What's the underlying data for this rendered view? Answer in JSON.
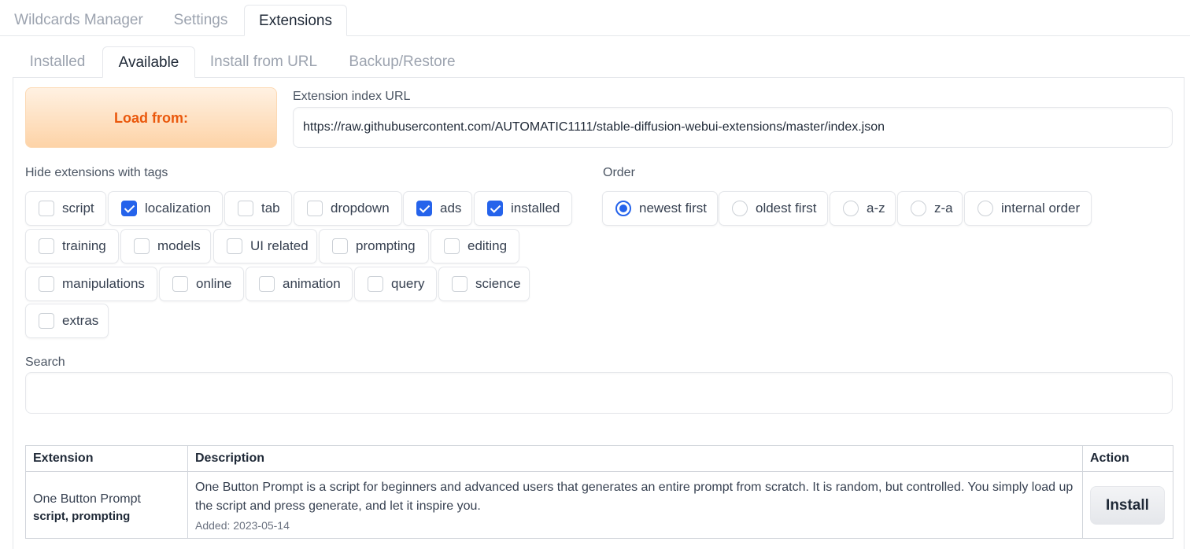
{
  "top_tabs": [
    "Wildcards Manager",
    "Settings",
    "Extensions"
  ],
  "sub_tabs": [
    "Installed",
    "Available",
    "Install from URL",
    "Backup/Restore"
  ],
  "load": {
    "button_label": "Load from:",
    "url_label": "Extension index URL",
    "url_value": "https://raw.githubusercontent.com/AUTOMATIC1111/stable-diffusion-webui-extensions/master/index.json"
  },
  "hide_tags": {
    "label": "Hide extensions with tags",
    "tags": [
      {
        "label": "script",
        "checked": false
      },
      {
        "label": "localization",
        "checked": true
      },
      {
        "label": "tab",
        "checked": false
      },
      {
        "label": "dropdown",
        "checked": false
      },
      {
        "label": "ads",
        "checked": true
      },
      {
        "label": "installed",
        "checked": true
      },
      {
        "label": "training",
        "checked": false
      },
      {
        "label": "models",
        "checked": false
      },
      {
        "label": "UI related",
        "checked": false
      },
      {
        "label": "prompting",
        "checked": false
      },
      {
        "label": "editing",
        "checked": false
      },
      {
        "label": "manipulations",
        "checked": false
      },
      {
        "label": "online",
        "checked": false
      },
      {
        "label": "animation",
        "checked": false
      },
      {
        "label": "query",
        "checked": false
      },
      {
        "label": "science",
        "checked": false
      },
      {
        "label": "extras",
        "checked": false
      }
    ]
  },
  "order": {
    "label": "Order",
    "options": [
      {
        "label": "newest first",
        "selected": true
      },
      {
        "label": "oldest first",
        "selected": false
      },
      {
        "label": "a-z",
        "selected": false
      },
      {
        "label": "z-a",
        "selected": false
      },
      {
        "label": "internal order",
        "selected": false
      }
    ]
  },
  "search": {
    "label": "Search",
    "value": ""
  },
  "table": {
    "headers": [
      "Extension",
      "Description",
      "Action"
    ],
    "rows": [
      {
        "name": "One Button Prompt",
        "tags": "script, prompting",
        "description": "One Button Prompt is a script for beginners and advanced users that generates an entire prompt from scratch. It is random, but controlled. You simply load up the script and press generate, and let it inspire you.",
        "added": "Added: 2023-05-14",
        "action": "Install"
      }
    ]
  }
}
